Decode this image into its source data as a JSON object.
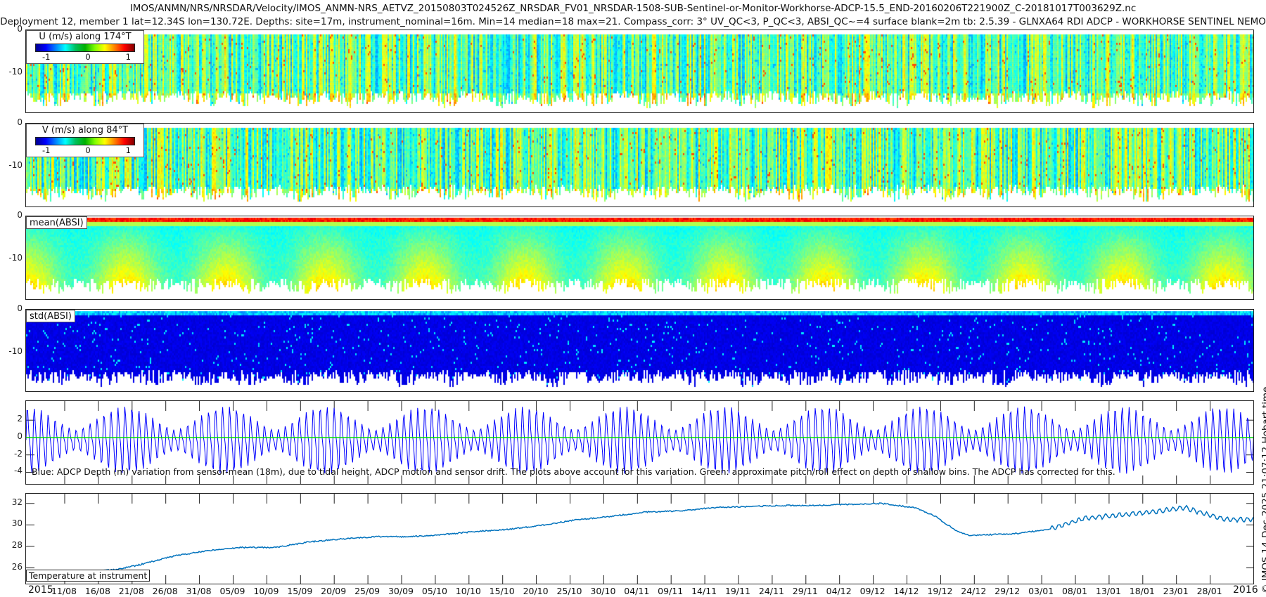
{
  "title_line1": "IMOS/ANMN/NRS/NRSDAR/Velocity/IMOS_ANMN-NRS_AETVZ_20150803T024526Z_NRSDAR_FV01_NRSDAR-1508-SUB-Sentinel-or-Monitor-Workhorse-ADCP-15.5_END-20160206T221900Z_C-20181017T003629Z.nc",
  "title_line2": "Deployment 12, member 1 lat=12.34S lon=130.72E. Depths: site=17m, instrument_nominal=16m. Min=14 median=18 max=21. Compass_corr: 3° UV_QC<3, P_QC<3, ABSI_QC~=4 surface blank=2m tb: 2.5.39 - GLNXA64 RDI ADCP - WORKHORSE SENTINEL NEMO",
  "side_label": "© IMOS 14-Dec-2025 21:07:12 Hobart time",
  "x_axis": {
    "year_start": "2015",
    "year_end": "2016",
    "ticks": [
      "11/08",
      "16/08",
      "21/08",
      "26/08",
      "31/08",
      "05/09",
      "10/09",
      "15/09",
      "20/09",
      "25/09",
      "30/09",
      "05/10",
      "10/10",
      "15/10",
      "20/10",
      "25/10",
      "30/10",
      "04/11",
      "09/11",
      "14/11",
      "19/11",
      "24/11",
      "29/11",
      "04/12",
      "09/12",
      "14/12",
      "19/12",
      "24/12",
      "29/12",
      "03/01",
      "08/01",
      "13/01",
      "18/01",
      "23/01",
      "28/01"
    ]
  },
  "chart_data": [
    {
      "type": "heatmap",
      "legend": "U (m/s) along 174°T",
      "colormap": "jet",
      "colorbar_ticks": [
        "-1",
        "0",
        "1"
      ],
      "clim": [
        -1.3,
        1.3
      ],
      "y_ticks": [
        "0",
        "-10"
      ],
      "ylim": [
        -19.5,
        0
      ]
    },
    {
      "type": "heatmap",
      "legend": "V (m/s) along 84°T",
      "colormap": "jet",
      "colorbar_ticks": [
        "-1",
        "0",
        "1"
      ],
      "clim": [
        -1.3,
        1.3
      ],
      "y_ticks": [
        "0",
        "-10"
      ],
      "ylim": [
        -19.5,
        0
      ]
    },
    {
      "type": "heatmap",
      "legend": "mean(ABSI)",
      "colormap": "jet",
      "y_ticks": [
        "0",
        "-10"
      ],
      "ylim": [
        -19.5,
        0
      ]
    },
    {
      "type": "heatmap",
      "legend": "std(ABSI)",
      "colormap": "jet",
      "y_ticks": [
        "0",
        "-10"
      ],
      "ylim": [
        -19.5,
        0
      ]
    },
    {
      "type": "line",
      "annotation": "Blue: ADCP Depth (m) variation from sensor-mean (18m), due to tidal height, ADCP motion and sensor drift. The plots above account for this variation. Green: approximate pitch/roll effect on depth of shallow bins. The ADCP has corrected for this.",
      "y_ticks": [
        "2",
        "0",
        "-2",
        "-4"
      ],
      "ylim": [
        -5.5,
        4.2
      ],
      "series": [
        {
          "color": "#0000ff",
          "amplitude_range": [
            1.0,
            3.3
          ]
        },
        {
          "color": "#00e000",
          "value": 0
        }
      ]
    },
    {
      "type": "line",
      "annotation": "Temperature at instrument",
      "y_ticks": [
        "26",
        "28",
        "30",
        "32"
      ],
      "ylim": [
        24.4,
        32.9
      ],
      "color": "#0072bd",
      "x": [
        "2015-08-05",
        "2015-08-07",
        "2015-08-10",
        "2015-08-15",
        "2015-08-20",
        "2015-08-23",
        "2015-08-26",
        "2015-08-31",
        "2015-09-05",
        "2015-09-10",
        "2015-09-15",
        "2015-09-20",
        "2015-09-25",
        "2015-09-30",
        "2015-10-05",
        "2015-10-10",
        "2015-10-15",
        "2015-10-20",
        "2015-10-25",
        "2015-10-30",
        "2015-11-04",
        "2015-11-09",
        "2015-11-14",
        "2015-11-19",
        "2015-11-24",
        "2015-11-29",
        "2015-12-04",
        "2015-12-09",
        "2015-12-14",
        "2015-12-19",
        "2015-12-22",
        "2015-12-25",
        "2015-12-27",
        "2016-01-03",
        "2016-01-08",
        "2016-01-13",
        "2016-01-18",
        "2016-01-23",
        "2016-01-28",
        "2016-02-03"
      ],
      "y": [
        25.8,
        25.4,
        25.4,
        25.6,
        25.7,
        25.9,
        26.3,
        27.1,
        27.6,
        27.9,
        27.9,
        28.4,
        28.7,
        28.9,
        28.9,
        29.1,
        29.4,
        29.6,
        30.0,
        30.5,
        30.8,
        31.2,
        31.3,
        31.6,
        31.7,
        31.8,
        31.8,
        31.9,
        32.0,
        31.6,
        30.8,
        29.5,
        29.0,
        29.2,
        29.6,
        30.6,
        30.9,
        31.2,
        31.6,
        30.5
      ]
    }
  ]
}
